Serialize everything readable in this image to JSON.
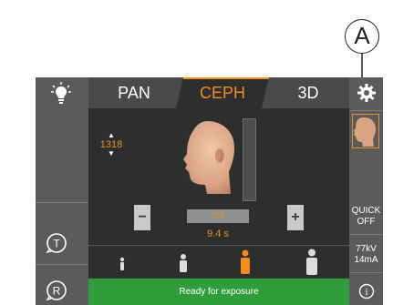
{
  "callout": {
    "label": "A"
  },
  "tabs": [
    {
      "label": "PAN",
      "active": false
    },
    {
      "label": "CEPH",
      "active": true
    },
    {
      "label": "3D",
      "active": false
    }
  ],
  "patient_height": {
    "value": "1318"
  },
  "program": {
    "label": "C3"
  },
  "exposure_time": "9.4 s",
  "status": {
    "text": "Ready for exposure"
  },
  "quick_mode": {
    "line1": "QUICK",
    "line2": "OFF"
  },
  "exposure_values": {
    "kv": "77kV",
    "ma": "14mA"
  },
  "left_rail": {
    "top_icon": "light-bulb-icon",
    "t_button": {
      "label": "T",
      "icon": "rotate-t-icon"
    },
    "r_button": {
      "label": "R",
      "icon": "rotate-r-icon"
    }
  },
  "right_rail": {
    "settings_icon": "gear-icon",
    "info_icon": "info-icon",
    "info_label": "i"
  },
  "patient_sizes": [
    "child-small",
    "child",
    "adult-medium",
    "adult-large"
  ],
  "selected_patient_size": 2,
  "colors": {
    "accent": "#f28c1c",
    "panel": "#3c3e3d",
    "rail": "#5a5c5b",
    "status_ready": "#2f9e3a"
  }
}
